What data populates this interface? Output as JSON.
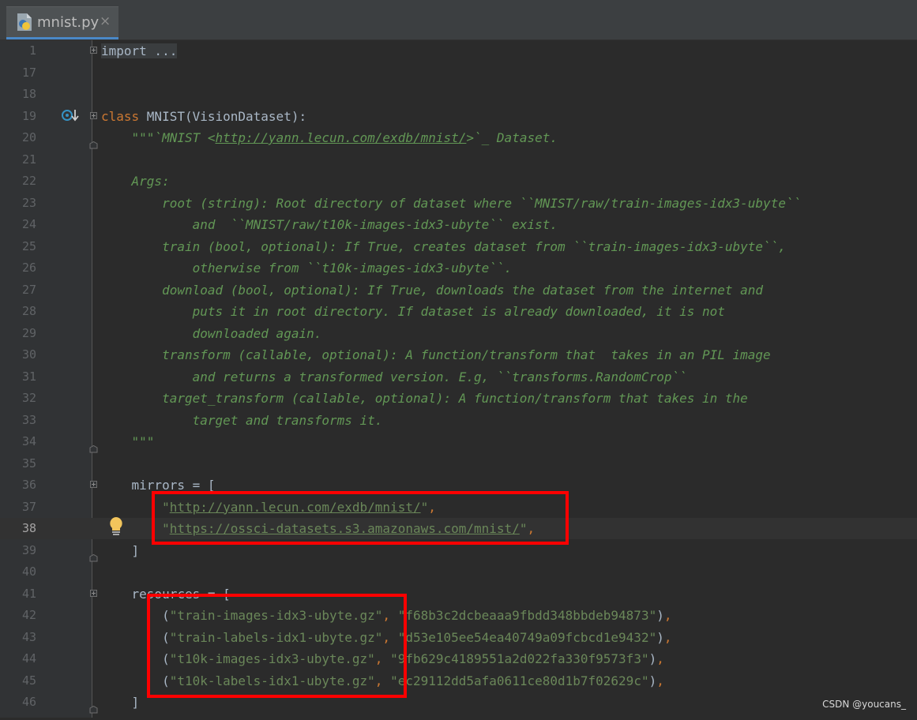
{
  "tab": {
    "filename": "mnist.py",
    "close": "×"
  },
  "lines": [
    {
      "n": "1",
      "seg": [
        {
          "t": "import ...",
          "c": "c-fold"
        }
      ],
      "fold": "open"
    },
    {
      "n": "17",
      "seg": []
    },
    {
      "n": "18",
      "seg": []
    },
    {
      "n": "19",
      "seg": [
        {
          "t": "class ",
          "c": "c-kw"
        },
        {
          "t": "MNIST(VisionDataset):",
          "c": "c-dim"
        }
      ],
      "fold": "open"
    },
    {
      "n": "20",
      "seg": [
        {
          "t": "    \"\"\"`MNIST <",
          "c": "c-doc"
        },
        {
          "t": "http://yann.lecun.com/exdb/mnist/",
          "c": "c-doc-url"
        },
        {
          "t": ">`_ Dataset.",
          "c": "c-doc"
        }
      ],
      "fold": "end"
    },
    {
      "n": "21",
      "seg": []
    },
    {
      "n": "22",
      "seg": [
        {
          "t": "    Args:",
          "c": "c-doc"
        }
      ]
    },
    {
      "n": "23",
      "seg": [
        {
          "t": "        root (string): Root directory of dataset where ``MNIST/raw/train-images-idx3-ubyte``",
          "c": "c-doc"
        }
      ]
    },
    {
      "n": "24",
      "seg": [
        {
          "t": "            and  ``MNIST/raw/t10k-images-idx3-ubyte`` exist.",
          "c": "c-doc"
        }
      ]
    },
    {
      "n": "25",
      "seg": [
        {
          "t": "        train (bool, optional): If True, creates dataset from ``train-images-idx3-ubyte``,",
          "c": "c-doc"
        }
      ]
    },
    {
      "n": "26",
      "seg": [
        {
          "t": "            otherwise from ``t10k-images-idx3-ubyte``.",
          "c": "c-doc"
        }
      ]
    },
    {
      "n": "27",
      "seg": [
        {
          "t": "        download (bool, optional): If True, downloads the dataset from the internet and",
          "c": "c-doc"
        }
      ]
    },
    {
      "n": "28",
      "seg": [
        {
          "t": "            puts it in root directory. If dataset is already downloaded, it is not",
          "c": "c-doc"
        }
      ]
    },
    {
      "n": "29",
      "seg": [
        {
          "t": "            downloaded again.",
          "c": "c-doc"
        }
      ]
    },
    {
      "n": "30",
      "seg": [
        {
          "t": "        transform (callable, optional): A function/transform that  takes in an PIL image",
          "c": "c-doc"
        }
      ]
    },
    {
      "n": "31",
      "seg": [
        {
          "t": "            and returns a transformed version. E.g, ``transforms.RandomCrop``",
          "c": "c-doc"
        }
      ]
    },
    {
      "n": "32",
      "seg": [
        {
          "t": "        target_transform (callable, optional): A function/transform that takes in the",
          "c": "c-doc"
        }
      ]
    },
    {
      "n": "33",
      "seg": [
        {
          "t": "            target and transforms it.",
          "c": "c-doc"
        }
      ]
    },
    {
      "n": "34",
      "seg": [
        {
          "t": "    \"\"\"",
          "c": "c-doc"
        }
      ],
      "fold": "end"
    },
    {
      "n": "35",
      "seg": []
    },
    {
      "n": "36",
      "seg": [
        {
          "t": "    mirrors = [",
          "c": "c-dim"
        }
      ],
      "fold": "open"
    },
    {
      "n": "37",
      "seg": [
        {
          "t": "        \"",
          "c": "c-str"
        },
        {
          "t": "http://yann.lecun.com/exdb/mnist/",
          "c": "c-url"
        },
        {
          "t": "\"",
          "c": "c-str"
        },
        {
          "t": ",",
          "c": "c-kw"
        }
      ]
    },
    {
      "n": "38",
      "seg": [
        {
          "t": "        \"",
          "c": "c-str"
        },
        {
          "t": "https://ossci-datasets.s3.amazonaws.com/mnist/",
          "c": "c-url"
        },
        {
          "t": "\"",
          "c": "c-str"
        },
        {
          "t": ",",
          "c": "c-kw"
        }
      ],
      "current": true
    },
    {
      "n": "39",
      "seg": [
        {
          "t": "    ]",
          "c": "c-dim"
        }
      ],
      "fold": "end"
    },
    {
      "n": "40",
      "seg": []
    },
    {
      "n": "41",
      "seg": [
        {
          "t": "    resources = [",
          "c": "c-dim"
        }
      ],
      "fold": "open"
    },
    {
      "n": "42",
      "seg": [
        {
          "t": "        (",
          "c": "c-dim"
        },
        {
          "t": "\"train-images-idx3-ubyte.gz\"",
          "c": "c-str"
        },
        {
          "t": ", ",
          "c": "c-kw"
        },
        {
          "t": "\"f68b3c2dcbeaaa9fbdd348bbdeb94873\"",
          "c": "c-str"
        },
        {
          "t": ")",
          "c": "c-dim"
        },
        {
          "t": ",",
          "c": "c-kw"
        }
      ]
    },
    {
      "n": "43",
      "seg": [
        {
          "t": "        (",
          "c": "c-dim"
        },
        {
          "t": "\"train-labels-idx1-ubyte.gz\"",
          "c": "c-str"
        },
        {
          "t": ", ",
          "c": "c-kw"
        },
        {
          "t": "\"d53e105ee54ea40749a09fcbcd1e9432\"",
          "c": "c-str"
        },
        {
          "t": ")",
          "c": "c-dim"
        },
        {
          "t": ",",
          "c": "c-kw"
        }
      ]
    },
    {
      "n": "44",
      "seg": [
        {
          "t": "        (",
          "c": "c-dim"
        },
        {
          "t": "\"t10k-images-idx3-ubyte.gz\"",
          "c": "c-str"
        },
        {
          "t": ", ",
          "c": "c-kw"
        },
        {
          "t": "\"9fb629c4189551a2d022fa330f9573f3\"",
          "c": "c-str"
        },
        {
          "t": ")",
          "c": "c-dim"
        },
        {
          "t": ",",
          "c": "c-kw"
        }
      ]
    },
    {
      "n": "45",
      "seg": [
        {
          "t": "        (",
          "c": "c-dim"
        },
        {
          "t": "\"t10k-labels-idx1-ubyte.gz\"",
          "c": "c-str"
        },
        {
          "t": ", ",
          "c": "c-kw"
        },
        {
          "t": "\"ec29112dd5afa0611ce80d1b7f02629c\"",
          "c": "c-str"
        },
        {
          "t": ")",
          "c": "c-dim"
        },
        {
          "t": ",",
          "c": "c-kw"
        }
      ]
    },
    {
      "n": "46",
      "seg": [
        {
          "t": "    ]",
          "c": "c-dim"
        }
      ],
      "fold": "end"
    }
  ],
  "watermark": "CSDN @youcans_",
  "colors": {
    "background": "#2b2b2b",
    "gutter": "#313335",
    "keyword": "#cc7832",
    "docstring": "#629755",
    "string": "#6a8759",
    "highlight_box": "#ff0000"
  },
  "icons": [
    "python-file-icon",
    "close-icon",
    "override-method-icon",
    "intention-bulb-icon",
    "fold-icon"
  ]
}
